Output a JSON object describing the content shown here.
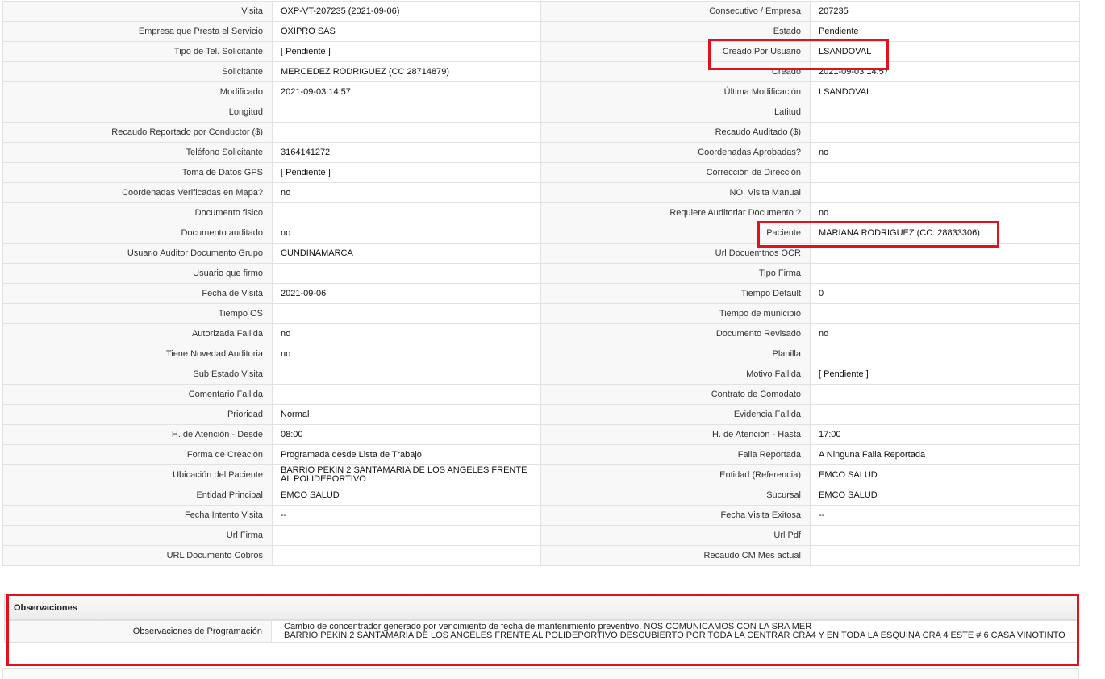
{
  "rows": [
    {
      "l1": "Visita",
      "v1": "OXP-VT-207235 (2021-09-06)",
      "l2": "Consecutivo / Empresa",
      "v2": "207235"
    },
    {
      "l1": "Empresa que Presta el Servicio",
      "v1": "OXIPRO SAS",
      "l2": "Estado",
      "v2": "Pendiente"
    },
    {
      "l1": "Tipo de Tel. Solicitante",
      "v1": "[ Pendiente ]",
      "l2": "Creado Por Usuario",
      "v2": "LSANDOVAL"
    },
    {
      "l1": "Solicitante",
      "v1": "MERCEDEZ RODRIGUEZ (CC 28714879)",
      "l2": "Creado",
      "v2": "2021-09-03 14:57"
    },
    {
      "l1": "Modificado",
      "v1": "2021-09-03 14:57",
      "l2": "Última Modificación",
      "v2": "LSANDOVAL"
    },
    {
      "l1": "Longitud",
      "v1": "",
      "l2": "Latitud",
      "v2": ""
    },
    {
      "l1": "Recaudo Reportado por Conductor ($)",
      "v1": "",
      "l2": "Recaudo Auditado ($)",
      "v2": ""
    },
    {
      "l1": "Teléfono Solicitante",
      "v1": "3164141272",
      "l2": "Coordenadas Aprobadas?",
      "v2": "no"
    },
    {
      "l1": "Toma de Datos GPS",
      "v1": "[ Pendiente ]",
      "l2": "Corrección de Dirección",
      "v2": ""
    },
    {
      "l1": "Coordenadas Verificadas en Mapa?",
      "v1": "no",
      "l2": "NO. Visita Manual",
      "v2": ""
    },
    {
      "l1": "Documento fisico",
      "v1": "",
      "l2": "Requiere Auditoriar Documento ?",
      "v2": "no"
    },
    {
      "l1": "Documento auditado",
      "v1": "no",
      "l2": "Paciente",
      "v2": "MARIANA RODRIGUEZ (CC: 28833306)"
    },
    {
      "l1": "Usuario Auditor Documento Grupo",
      "v1": "CUNDINAMARCA",
      "l2": "Url Docuemtnos OCR",
      "v2": ""
    },
    {
      "l1": "Usuario que firmo",
      "v1": "",
      "l2": "Tipo Firma",
      "v2": ""
    },
    {
      "l1": "Fecha de Visita",
      "v1": "2021-09-06",
      "l2": "Tiempo Default",
      "v2": "0"
    },
    {
      "l1": "Tiempo OS",
      "v1": "",
      "l2": "Tiempo de municipio",
      "v2": ""
    },
    {
      "l1": "Autorizada Fallida",
      "v1": "no",
      "l2": "Documento Revisado",
      "v2": "no"
    },
    {
      "l1": "Tiene Novedad Auditoria",
      "v1": "no",
      "l2": "Planilla",
      "v2": ""
    },
    {
      "l1": "Sub Estado Visita",
      "v1": "",
      "l2": "Motivo Fallida",
      "v2": "[ Pendiente ]"
    },
    {
      "l1": "Comentario Fallida",
      "v1": "",
      "l2": "Contrato de Comodato",
      "v2": ""
    },
    {
      "l1": "Prioridad",
      "v1": "Normal",
      "l2": "Evidencia Fallida",
      "v2": ""
    },
    {
      "l1": "H. de Atención - Desde",
      "v1": "08:00",
      "l2": "H. de Atención - Hasta",
      "v2": "17:00"
    },
    {
      "l1": "Forma de Creación",
      "v1": "Programada desde Lista de Trabajo",
      "l2": "Falla Reportada",
      "v2": "A Ninguna Falla Reportada"
    },
    {
      "l1": "Ubicación del Paciente",
      "v1": "BARRIO PEKIN 2 SANTAMARIA DE LOS ANGELES FRENTE AL POLIDEPORTIVO",
      "l2": "Entidad (Referencia)",
      "v2": "EMCO SALUD"
    },
    {
      "l1": "Entidad Principal",
      "v1": "EMCO SALUD",
      "l2": "Sucursal",
      "v2": "EMCO SALUD"
    },
    {
      "l1": "Fecha Intento Visita",
      "v1": "--",
      "l2": "Fecha Visita Exitosa",
      "v2": "--"
    },
    {
      "l1": "Url Firma",
      "v1": "",
      "l2": "Url Pdf",
      "v2": ""
    },
    {
      "l1": "URL Documento Cobros",
      "v1": "",
      "l2": "Recaudo CM Mes actual",
      "v2": ""
    }
  ],
  "observaciones": {
    "title": "Observaciones",
    "label": "Observaciones de Programación",
    "line1": "Cambio de concentrador generado por vencimiento de fecha de mantenimiento preventivo. NOS COMUNICAMOS CON LA SRA MER",
    "line2": "BARRIO PEKIN 2 SANTAMARIA DE LOS ANGELES FRENTE AL POLIDEPORTIVO DESCUBIERTO POR TODA LA CENTRAR CRA4 Y EN TODA LA ESQUINA CRA 4 ESTE # 6 CASA VINOTINTO"
  },
  "colors": {
    "highlight": "#e0121f",
    "label_bg": "#f8f8f8",
    "border": "#e2e2e2"
  }
}
